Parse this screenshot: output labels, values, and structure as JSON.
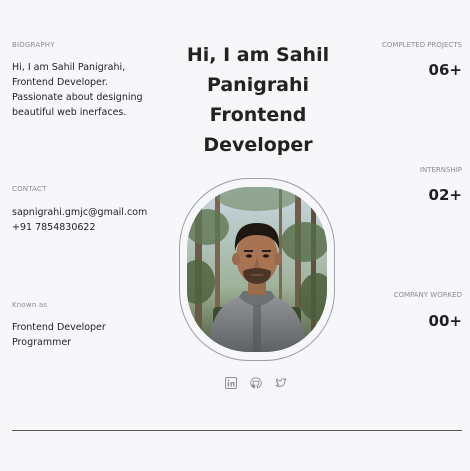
{
  "biography": {
    "label": "BIOGRAPHY",
    "lines": [
      "Hi, I am Sahil Panigrahi,",
      "Frontend Developer.",
      "Passionate about designing",
      "beautiful web inerfaces."
    ]
  },
  "contact": {
    "label": "CONTACT",
    "email": "sapnigrahi.gmjc@gmail.com",
    "phone": "+91 7854830622"
  },
  "known_as": {
    "label": "Known as",
    "roles": [
      "Frontend Developer",
      "Programmer"
    ]
  },
  "hero": {
    "lines": [
      "Hi, I am Sahil",
      "Panigrahi",
      "Frontend",
      "Developer"
    ]
  },
  "stats": [
    {
      "label": "COMPLETED PROJECTS",
      "value": "06+"
    },
    {
      "label": "INTERNSHIP",
      "value": "02+"
    },
    {
      "label": "COMPANY WORKED",
      "value": "00+"
    }
  ],
  "socials": [
    "linkedin-icon",
    "github-icon",
    "twitter-icon"
  ],
  "colors": {
    "background": "#f7f7fa",
    "text": "#1f1f24",
    "muted": "#8a8a94",
    "icon": "#8a8f96"
  }
}
